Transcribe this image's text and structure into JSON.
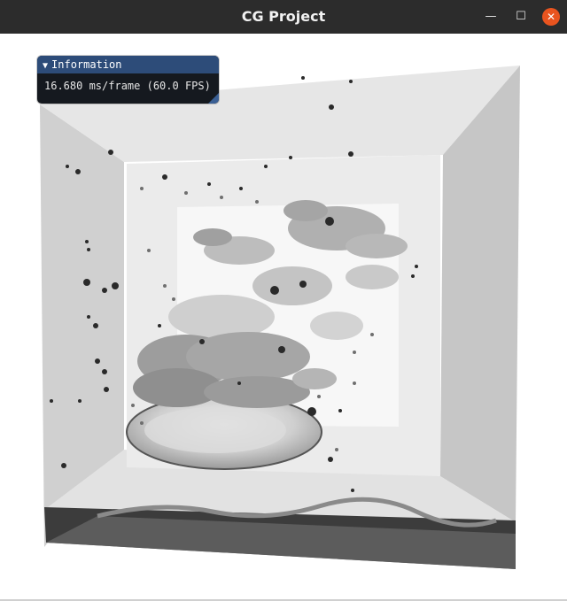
{
  "window": {
    "title": "CG Project",
    "minimize_glyph": "—",
    "maximize_glyph": "☐",
    "close_glyph": "✕"
  },
  "info_panel": {
    "header_arrow": "▼",
    "header_title": "Information",
    "frame_stats": "16.680 ms/frame (60.0 FPS)"
  },
  "colors": {
    "titlebar": "#2c2c2c",
    "close_button": "#e9541f",
    "panel_header": "#2d4c79",
    "panel_body": "#15191f"
  },
  "icons": [
    "minimize-icon",
    "maximize-icon",
    "close-icon",
    "collapse-arrow-icon",
    "resize-grip-icon"
  ]
}
